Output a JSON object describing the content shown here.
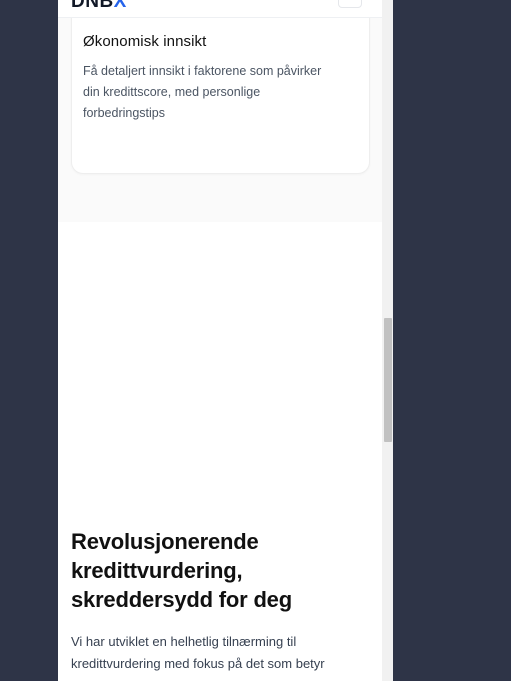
{
  "header": {
    "logo_main": "DNB",
    "logo_accent": "X"
  },
  "feature_card": {
    "title": "Økonomisk innsikt",
    "description": "Få detaljert innsikt i faktorene som påvirker din kredittscore, med personlige forbedringstips"
  },
  "hero": {
    "title": "Revolusjonerende kredittvurdering, skreddersydd for deg",
    "text": "Vi har utviklet en helhetlig tilnærming til kredittvurdering med fokus på det som betyr"
  },
  "colors": {
    "background": "#2e3447",
    "logo_accent": "#2563eb"
  },
  "icons": {
    "menu": "hamburger-menu-icon"
  }
}
